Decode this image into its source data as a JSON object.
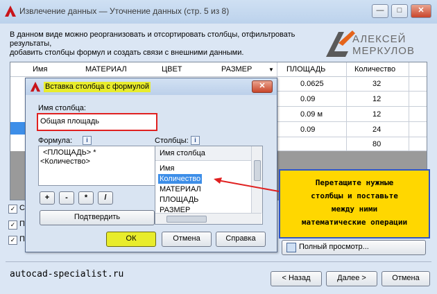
{
  "window": {
    "title": "Извлечение данных — Уточнение данных (стр. 5 из 8)",
    "minimize_label": "—",
    "maximize_label": "□",
    "close_label": "✕"
  },
  "intro_text_1": "В данном виде можно реорганизовать и отсортировать столбцы, отфильтровать результаты,",
  "intro_text_2": "добавить столбцы формул и создать связи с внешними данными.",
  "logo": {
    "line1": "АЛЕКСЕЙ",
    "line2": "МЕРКУЛОВ"
  },
  "table": {
    "headers": [
      "Имя",
      "МАТЕРИАЛ",
      "ЦВЕТ",
      "РАЗМЕР",
      "ПЛОЩАДЬ",
      "Количество"
    ],
    "sort_icon": "▼",
    "area_values": [
      "0.0625",
      "0.09",
      "0.09 м",
      "0.09",
      ""
    ],
    "count_values": [
      "32",
      "12",
      "12",
      "24",
      "80"
    ]
  },
  "bottom_checkboxes": [
    "С",
    "П",
    "П"
  ],
  "full_view_label": "Полный просмотр...",
  "nav": {
    "back": "< Назад",
    "next": "Далее >",
    "cancel": "Отмена"
  },
  "watermark": "autocad-specialist.ru",
  "dialog": {
    "title": "Вставка столбца с формулой",
    "column_name_label": "Имя столбца:",
    "column_name_value": "Общая площадь",
    "formula_label": "Формула:",
    "formula_lines": [
      "<ПЛОЩАДЬ> *",
      "<Количество>"
    ],
    "columns_label": "Столбцы:",
    "columns_list_header": "Имя столбца",
    "columns": [
      "Имя",
      "Количество",
      "МАТЕРИАЛ",
      "ПЛОЩАДЬ",
      "РАЗМЕР"
    ],
    "selected_column": "Количество",
    "operators": [
      "+",
      "-",
      "*",
      "/"
    ],
    "confirm_label": "Подтвердить",
    "ok_label": "ОК",
    "cancel_label": "Отмена",
    "help_label": "Справка"
  },
  "callout_lines": [
    "Перетащите нужные",
    "столбцы и поставьте",
    "между ними",
    "математические операции"
  ],
  "colors": {
    "accent_red": "#e02020",
    "highlight_yellow": "#e8ec2c",
    "callout_yellow": "#ffd700",
    "selection_blue": "#3d8ee8"
  }
}
